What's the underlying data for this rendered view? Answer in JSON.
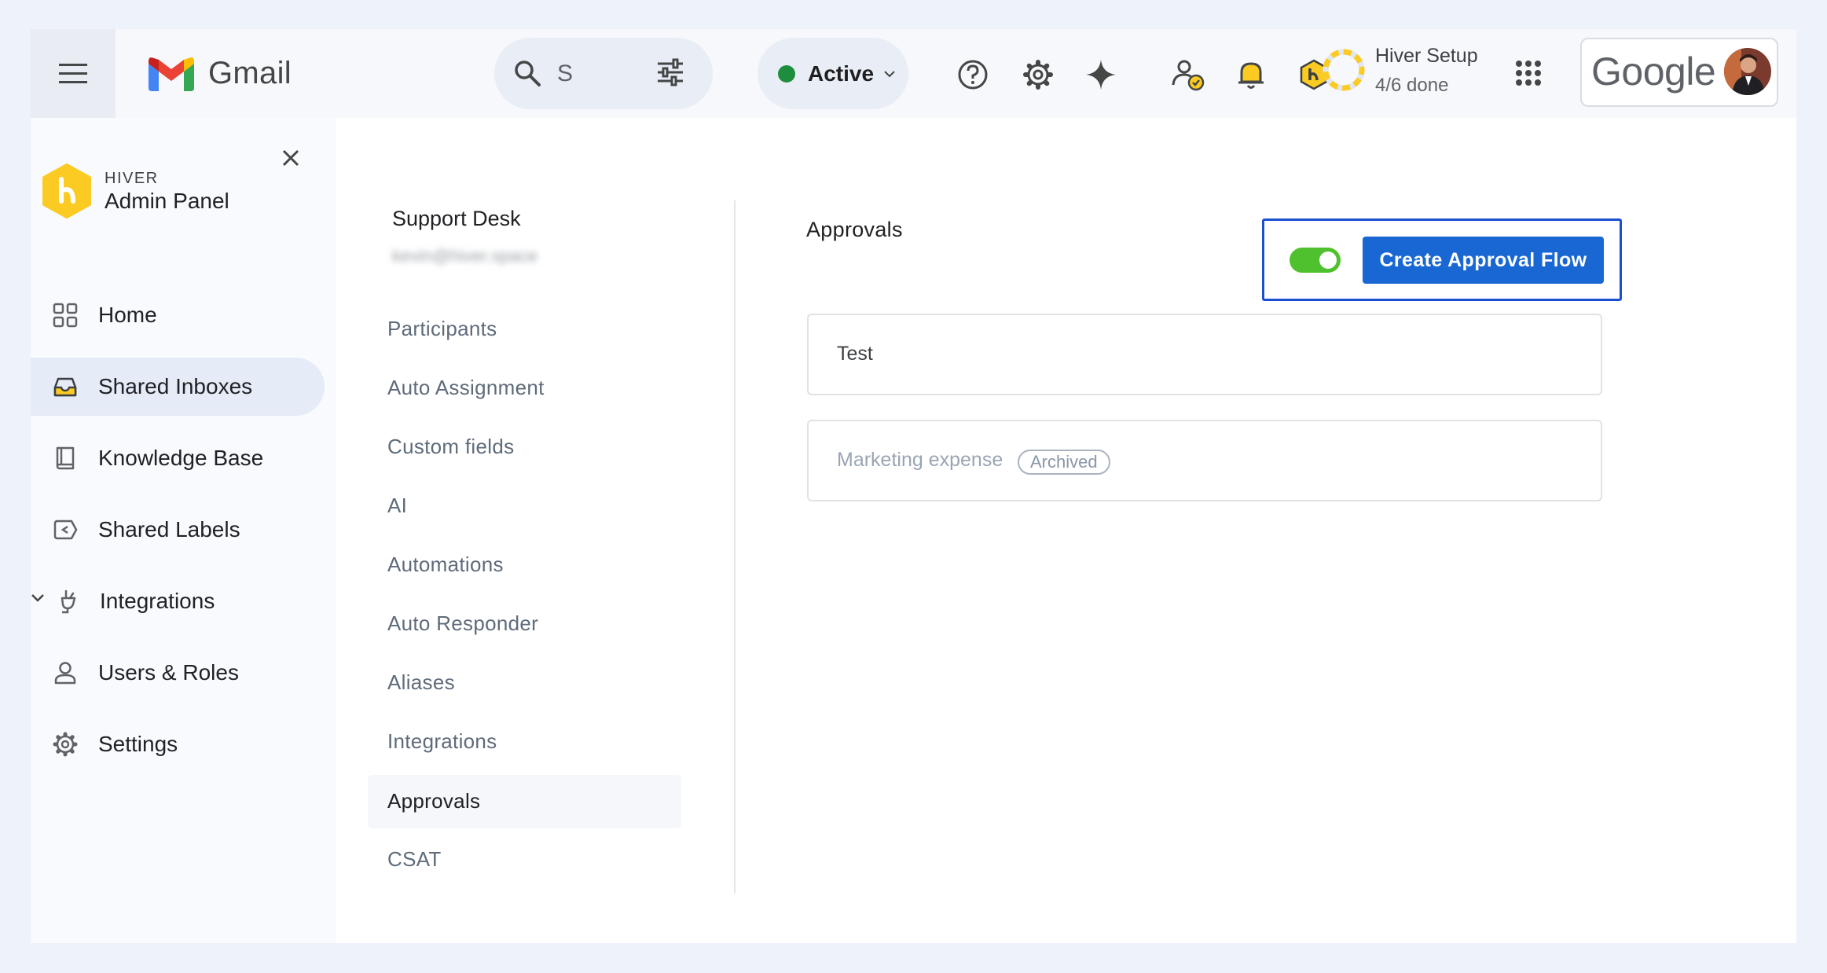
{
  "gmail": {
    "app_name": "Gmail",
    "search_value": "S",
    "status_label": "Active",
    "setup_title": "Hiver Setup",
    "setup_progress": "4/6 done",
    "setup_fraction": 0.667,
    "google_label": "Google",
    "icons": [
      "menu-icon",
      "search-icon",
      "tune-icon",
      "chevron-down-icon",
      "help-icon",
      "gear-icon",
      "sparkle-icon",
      "user-check-icon",
      "bell-icon",
      "hiver-badge-icon",
      "apps-grid-icon",
      "avatar"
    ]
  },
  "hiver": {
    "brand_small": "HIVER",
    "brand_big": "Admin Panel",
    "nav": [
      {
        "label": "Home",
        "icon": "grid-icon"
      },
      {
        "label": "Shared Inboxes",
        "icon": "inbox-icon",
        "active": true
      },
      {
        "label": "Knowledge Base",
        "icon": "book-icon"
      },
      {
        "label": "Shared Labels",
        "icon": "label-icon"
      },
      {
        "label": "Integrations",
        "icon": "plug-icon"
      },
      {
        "label": "Users & Roles",
        "icon": "user-icon"
      },
      {
        "label": "Settings",
        "icon": "gear-icon"
      }
    ]
  },
  "inbox": {
    "name": "Support Desk",
    "email": "kevin@hiver.space",
    "menu": [
      {
        "label": "Participants"
      },
      {
        "label": "Auto Assignment"
      },
      {
        "label": "Custom fields"
      },
      {
        "label": "AI"
      },
      {
        "label": "Automations"
      },
      {
        "label": "Auto Responder"
      },
      {
        "label": "Aliases"
      },
      {
        "label": "Integrations"
      },
      {
        "label": "Approvals",
        "active": true
      },
      {
        "label": "CSAT"
      }
    ]
  },
  "approvals": {
    "title": "Approvals",
    "toggle_on": true,
    "create_label": "Create Approval Flow",
    "flows": [
      {
        "name": "Test"
      },
      {
        "name": "Marketing expense",
        "badge": "Archived"
      }
    ]
  },
  "colors": {
    "accent": "#1967d2",
    "toggle_on": "#50c12e",
    "highlight_border": "#1a4fcf",
    "hiver_yellow": "#fbcb23",
    "active_green": "#1e8e3e"
  }
}
